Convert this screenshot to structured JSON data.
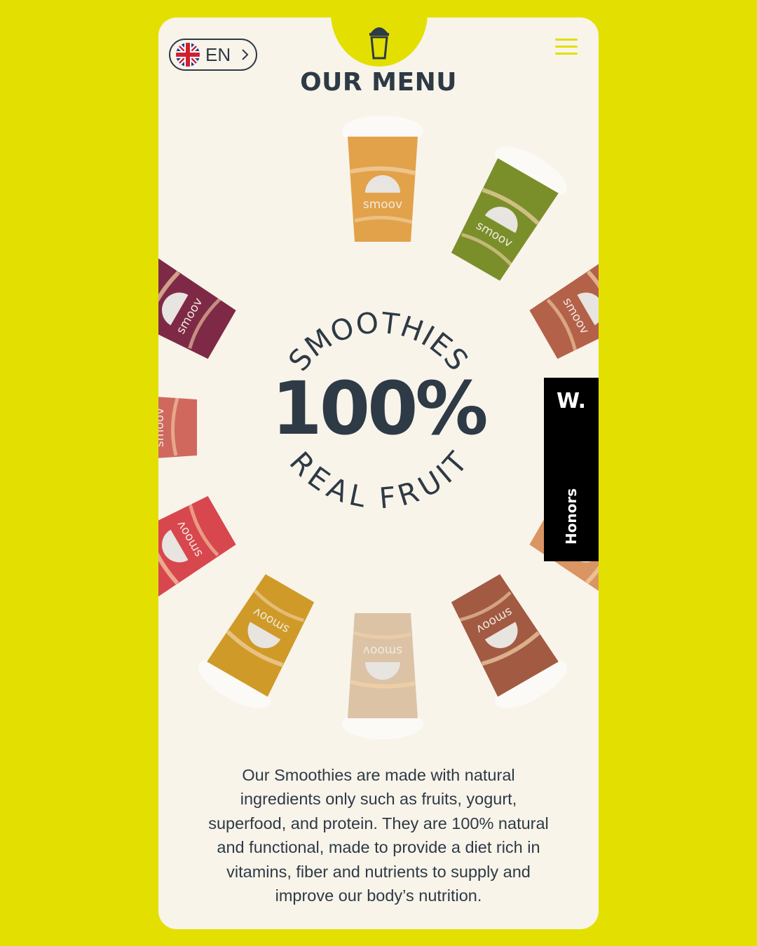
{
  "header": {
    "language_code": "EN",
    "language_icon": "uk-flag-icon",
    "menu_icon": "hamburger-menu-icon",
    "logo_icon": "smoothie-cup-icon"
  },
  "page_title": "OUR MENU",
  "hero": {
    "arc_top": "SMOOTHIES",
    "big_text": "100%",
    "arc_bottom": "REAL FRUIT",
    "cup_brand": "smoov",
    "cups": [
      {
        "color": "#e2a24a"
      },
      {
        "color": "#7a8f2a"
      },
      {
        "color": "#b4614a"
      },
      {
        "color": "#c98556"
      },
      {
        "color": "#d99562"
      },
      {
        "color": "#a25a42"
      },
      {
        "color": "#dcc3a6"
      },
      {
        "color": "#cf9a28"
      },
      {
        "color": "#d8474e"
      },
      {
        "color": "#d0685e"
      },
      {
        "color": "#7e2a46"
      }
    ]
  },
  "description": "Our Smoothies are made with natural ingredients only such as fruits, yogurt, superfood, and protein. They are 100% natural and functional, made to provide a diet rich in vitamins, fiber and nutrients to supply and improve our body’s nutrition.",
  "honors_badge": {
    "logo": "W.",
    "label": "Honors"
  },
  "colors": {
    "background": "#e3df00",
    "panel": "#f8f4ea",
    "text": "#2e3a45"
  }
}
